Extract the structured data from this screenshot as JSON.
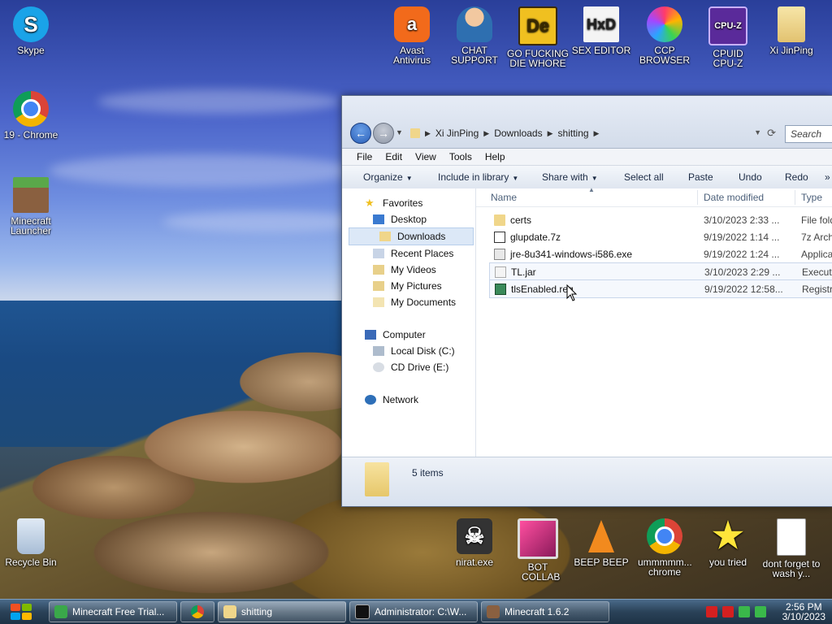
{
  "desktop": {
    "left_icons": [
      {
        "label": "Skype",
        "icon": "skype-icon"
      },
      {
        "label": "19 - Chrome",
        "icon": "chrome-icon"
      },
      {
        "label": "Minecraft Launcher",
        "icon": "minecraft-icon"
      },
      {
        "label": "Recycle Bin",
        "icon": "recycle-bin-icon"
      }
    ],
    "top_icons": [
      {
        "label": "Avast Antivirus",
        "icon": "avast-icon"
      },
      {
        "label": "CHAT SUPPORT",
        "icon": "support-person-icon"
      },
      {
        "label": "GO FUCKING DIE WHORE",
        "icon": "de-icon"
      },
      {
        "label": "SEX EDITOR",
        "icon": "hxd-icon"
      },
      {
        "label": "CCP BROWSER",
        "icon": "browser-icon"
      },
      {
        "label": "CPUID CPU-Z",
        "icon": "cpuz-icon"
      },
      {
        "label": "Xi JinPing",
        "icon": "user-folder-icon"
      }
    ],
    "bottom_icons": [
      {
        "label": "nirat.exe",
        "icon": "skull-icon"
      },
      {
        "label": "BOT COLLAB",
        "icon": "monitor-icon"
      },
      {
        "label": "BEEP BEEP",
        "icon": "vlc-cone-icon"
      },
      {
        "label": "ummmmm... chrome",
        "icon": "chrome-icon"
      },
      {
        "label": "you tried",
        "icon": "star-icon"
      },
      {
        "label": "dont forget to wash y...",
        "icon": "document-icon"
      }
    ]
  },
  "explorer": {
    "breadcrumb": [
      "Xi JinPing",
      "Downloads",
      "shitting"
    ],
    "search_placeholder": "Search",
    "menu": [
      "File",
      "Edit",
      "View",
      "Tools",
      "Help"
    ],
    "toolbar": [
      {
        "label": "Organize",
        "dropdown": true
      },
      {
        "label": "Include in library",
        "dropdown": true
      },
      {
        "label": "Share with",
        "dropdown": true
      },
      {
        "label": "Select all",
        "dropdown": false
      },
      {
        "label": "Paste",
        "dropdown": false
      },
      {
        "label": "Undo",
        "dropdown": false
      },
      {
        "label": "Redo",
        "dropdown": false
      }
    ],
    "nav": {
      "favorites_label": "Favorites",
      "favorites": [
        "Desktop",
        "Downloads",
        "Recent Places",
        "My Videos",
        "My Pictures",
        "My Documents"
      ],
      "computer_label": "Computer",
      "drives": [
        "Local Disk (C:)",
        "CD Drive (E:)"
      ],
      "network_label": "Network"
    },
    "columns": {
      "name": "Name",
      "date": "Date modified",
      "type": "Type"
    },
    "files": [
      {
        "name": "certs",
        "date": "3/10/2023 2:33 ...",
        "type": "File fold",
        "icon": "folder-icon"
      },
      {
        "name": "glupdate.7z",
        "date": "9/19/2022 1:14 ...",
        "type": "7z Arch",
        "icon": "archive-icon"
      },
      {
        "name": "jre-8u341-windows-i586.exe",
        "date": "9/19/2022 1:24 ...",
        "type": "Applica",
        "icon": "installer-icon"
      },
      {
        "name": "TL.jar",
        "date": "3/10/2023 2:29 ...",
        "type": "Execut",
        "icon": "jar-icon"
      },
      {
        "name": "tlsEnabled.reg",
        "date": "9/19/2022 12:58...",
        "type": "Registr",
        "icon": "registry-icon"
      }
    ],
    "status": "5 items"
  },
  "taskbar": {
    "items": [
      {
        "label": "Minecraft Free Trial...",
        "icon": "minecraft-icon"
      },
      {
        "label": "",
        "icon": "chrome-icon"
      },
      {
        "label": "shitting",
        "icon": "folder-icon"
      },
      {
        "label": "Administrator: C:\\W...",
        "icon": "cmd-icon"
      },
      {
        "label": "Minecraft 1.6.2",
        "icon": "minecraft-icon"
      }
    ],
    "clock_time": "2:56 PM",
    "clock_date": "3/10/2023"
  }
}
